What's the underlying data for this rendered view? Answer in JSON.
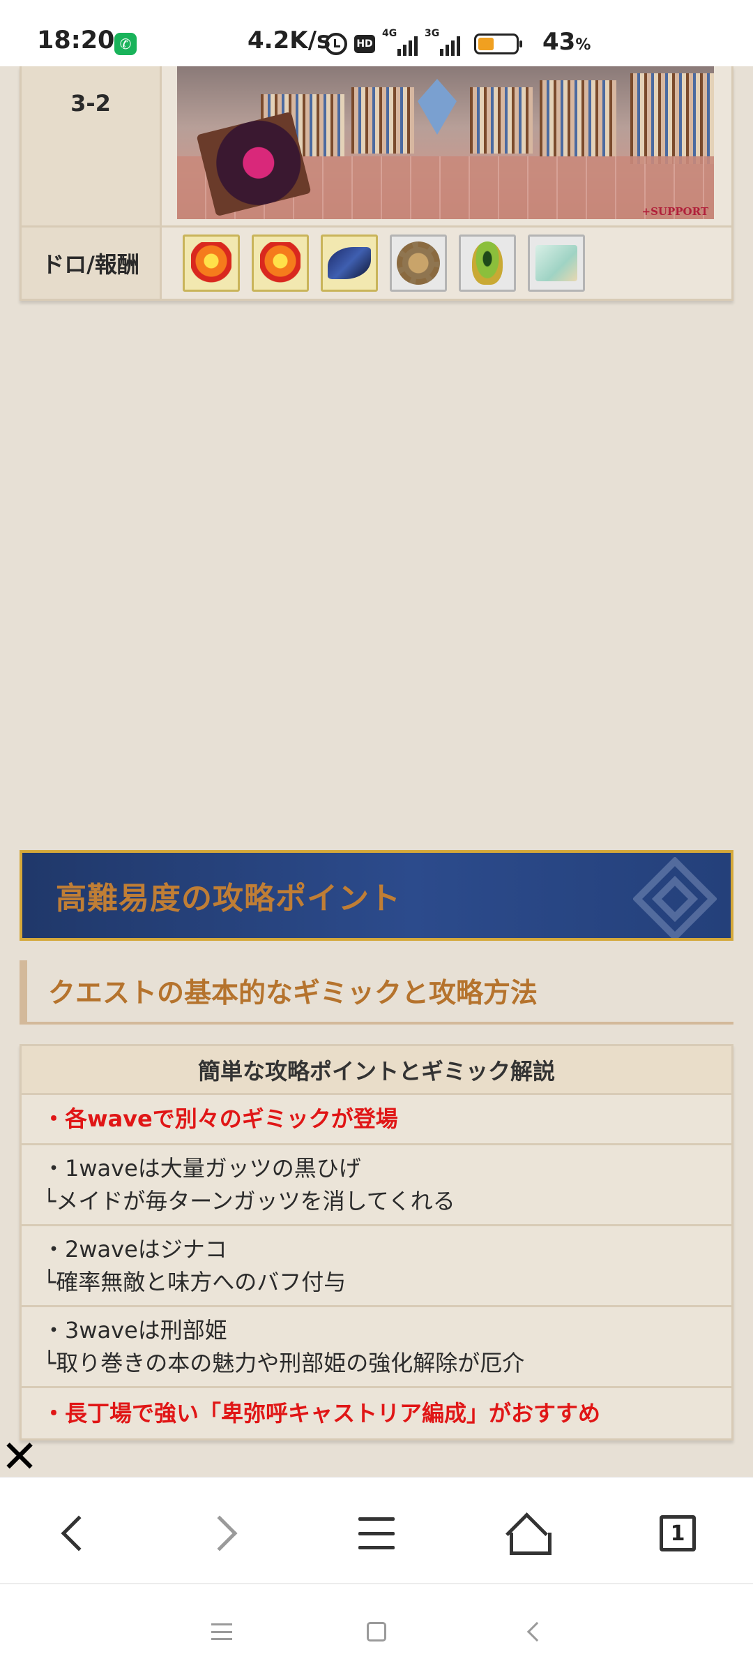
{
  "status_bar": {
    "time": "18:20",
    "network_speed": "4.2K/s",
    "signal1_tag": "4G",
    "signal2_tag": "3G",
    "battery_percent": "43",
    "battery_unit": "%",
    "battery_level": 0.43,
    "icons": [
      "phone-call-icon",
      "alarm-icon",
      "hd-icon",
      "signal-4g-icon",
      "signal-3g-icon",
      "battery-icon"
    ]
  },
  "quest_table": {
    "stage_label": "3-2",
    "stage_image_caption": "+SUPPORT",
    "drops_label": "ドロ/報酬",
    "drop_items": [
      {
        "icon": "heart-gem-icon",
        "frame": "gold"
      },
      {
        "icon": "heart-gem-icon",
        "frame": "gold"
      },
      {
        "icon": "dark-claw-icon",
        "frame": "gold"
      },
      {
        "icon": "gear-icon",
        "frame": "silver"
      },
      {
        "icon": "serpent-eye-icon",
        "frame": "silver"
      },
      {
        "icon": "scroll-icon",
        "frame": "silver"
      }
    ]
  },
  "banner": {
    "title": "高難易度の攻略ポイント"
  },
  "subsection": {
    "title": "クエストの基本的なギミックと攻略方法"
  },
  "tips_table": {
    "header": "簡単な攻略ポイントとギミック解説",
    "rows": [
      {
        "lines": [
          "・各waveで別々のギミックが登場"
        ],
        "highlight": true
      },
      {
        "lines": [
          "・1waveは大量ガッツの黒ひげ",
          "└メイドが毎ターンガッツを消してくれる"
        ],
        "highlight": false
      },
      {
        "lines": [
          "・2waveはジナコ",
          "└確率無敵と味方へのバフ付与"
        ],
        "highlight": false
      },
      {
        "lines": [
          "・3waveは刑部姫",
          "└取り巻きの本の魅力や刑部姫の強化解除が厄介"
        ],
        "highlight": false
      },
      {
        "lines": [
          "・長丁場で強い「卑弥呼キャストリア編成」がおすすめ"
        ],
        "highlight": true
      }
    ]
  },
  "close_button": {
    "glyph": "✕"
  },
  "browser_toolbar": {
    "tab_count": "1",
    "buttons": [
      "back-icon",
      "forward-icon",
      "menu-icon",
      "home-icon",
      "tabs-icon"
    ]
  },
  "system_nav": {
    "buttons": [
      "recent-apps-icon",
      "home-square-icon",
      "back-triangle-icon"
    ]
  },
  "colors": {
    "page_bg": "#e7e0d5",
    "banner_bg": "#2c4b8c",
    "banner_border": "#d4a83a",
    "banner_text": "#c07e35",
    "subhead_text": "#b5732d",
    "highlight_red": "#e01616",
    "battery_fill": "#f0a020"
  }
}
